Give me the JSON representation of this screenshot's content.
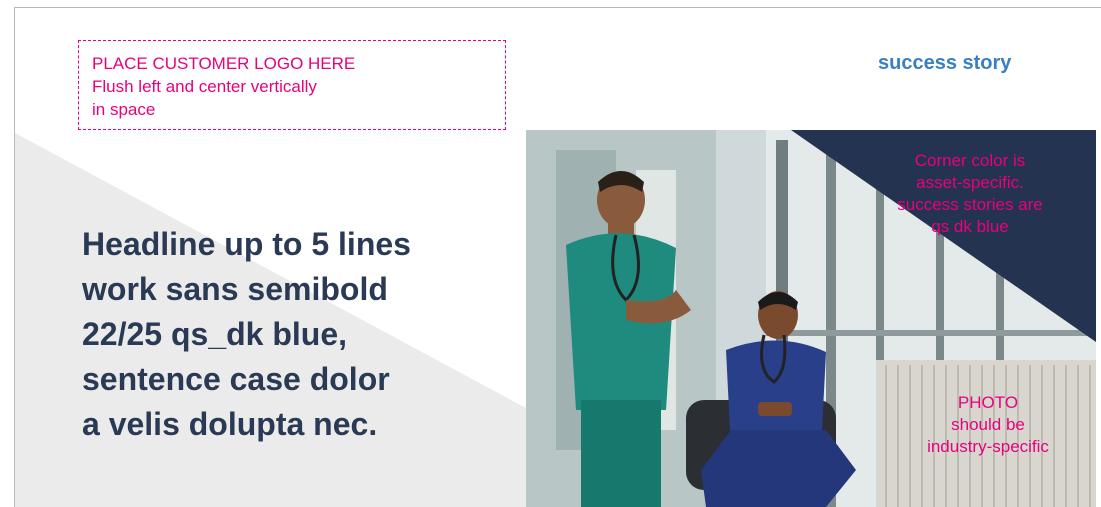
{
  "logo_placeholder": {
    "lines": [
      "PLACE CUSTOMER LOGO HERE",
      "Flush left and center vertically",
      "in space"
    ]
  },
  "label": "success story",
  "headline": {
    "lines": [
      "Headline up to 5 lines",
      "work sans semibold",
      "22/25 qs_dk blue,",
      "sentence case dolor",
      "a velis dolupta nec."
    ]
  },
  "corner_note": {
    "lines": [
      "Corner color is",
      "asset-specific.",
      "success stories are",
      "qs dk blue"
    ]
  },
  "photo_note": {
    "lines": [
      "PHOTO",
      "should be",
      "industry-specific"
    ]
  },
  "colors": {
    "accent_pink": "#e8007d",
    "label_blue": "#3a7fc1",
    "headline_dark_blue": "#2a3a55",
    "corner_dark_blue": "#243350"
  }
}
